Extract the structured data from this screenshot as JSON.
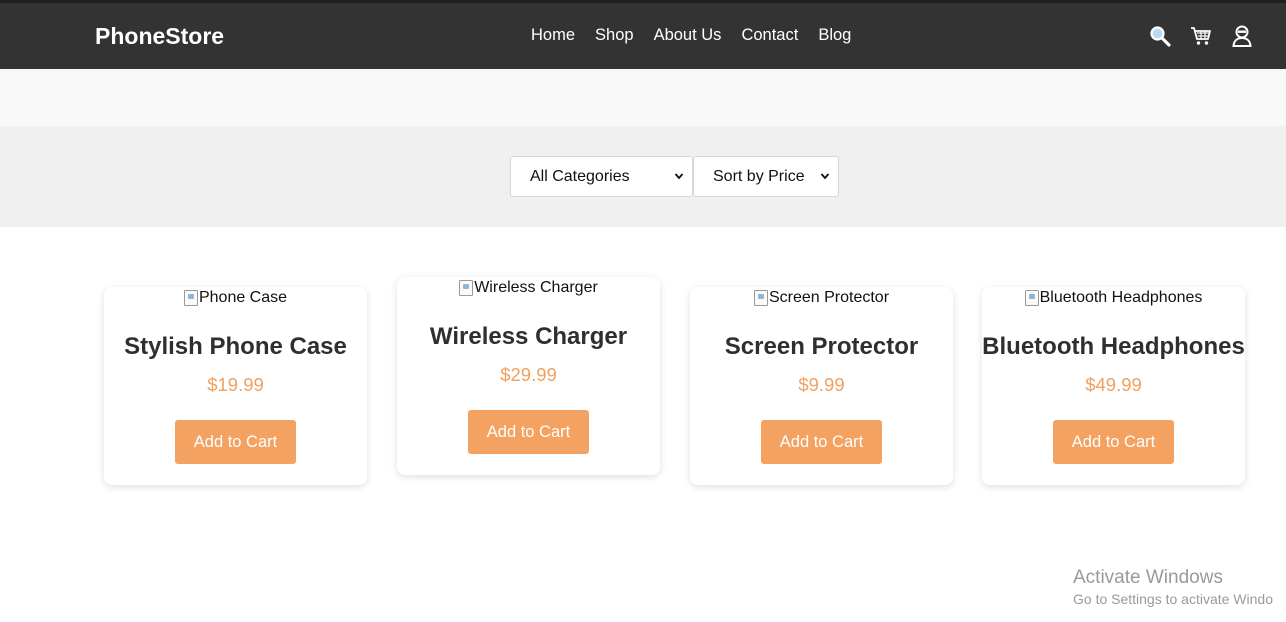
{
  "header": {
    "logo": "PhoneStore",
    "nav": [
      "Home",
      "Shop",
      "About Us",
      "Contact",
      "Blog"
    ],
    "icons": [
      "search-icon",
      "cart-icon",
      "user-icon"
    ]
  },
  "filters": {
    "category": "All Categories",
    "sort": "Sort by Price"
  },
  "products": [
    {
      "image_alt": "Phone Case",
      "name": "Stylish Phone Case",
      "price": "$19.99",
      "button": "Add to Cart"
    },
    {
      "image_alt": "Wireless Charger",
      "name": "Wireless Charger",
      "price": "$29.99",
      "button": "Add to Cart"
    },
    {
      "image_alt": "Screen Protector",
      "name": "Screen Protector",
      "price": "$9.99",
      "button": "Add to Cart"
    },
    {
      "image_alt": "Bluetooth Headphones",
      "name": "Bluetooth Headphones",
      "price": "$49.99",
      "button": "Add to Cart"
    }
  ],
  "watermark": {
    "title": "Activate Windows",
    "subtitle": "Go to Settings to activate Windo"
  },
  "colors": {
    "header_bg": "#333333",
    "accent": "#f4a261",
    "price": "#f0a060"
  }
}
